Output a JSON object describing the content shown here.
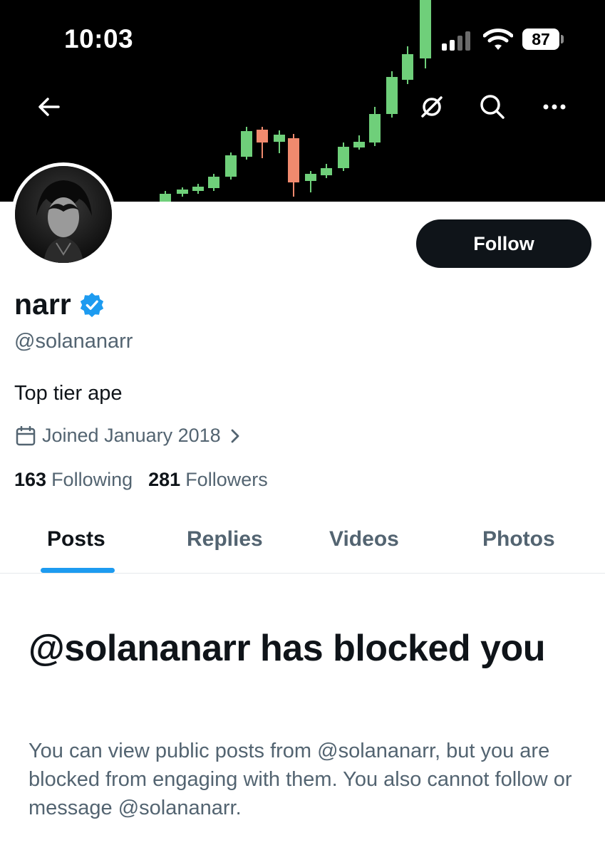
{
  "status_bar": {
    "time": "10:03",
    "battery": "87"
  },
  "header": {
    "back_icon": "arrow-left-icon",
    "grok_icon": "grok-slash-circle-icon",
    "search_icon": "search-icon",
    "more_icon": "more-horizontal-icon"
  },
  "profile": {
    "name": "narr",
    "handle": "@solananarr",
    "bio": "Top tier ape",
    "joined": "Joined January 2018",
    "following_count": "163",
    "following_label": "Following",
    "followers_count": "281",
    "followers_label": "Followers",
    "follow_label": "Follow",
    "verified_color": "#1d9bf0"
  },
  "tabs": [
    {
      "label": "Posts",
      "active": true
    },
    {
      "label": "Replies",
      "active": false
    },
    {
      "label": "Videos",
      "active": false
    },
    {
      "label": "Photos",
      "active": false
    }
  ],
  "blocked_notice": {
    "title": "@solananarr has blocked you",
    "body": "You can view public posts from @solananarr, but you are blocked from engaging with them. You also cannot follow or message @solananarr."
  },
  "colors": {
    "accent": "#1d9bf0",
    "candle_up": "#6fcf7a",
    "candle_down": "#f08a6e",
    "text_primary": "#0f1419",
    "text_secondary": "#536471"
  }
}
